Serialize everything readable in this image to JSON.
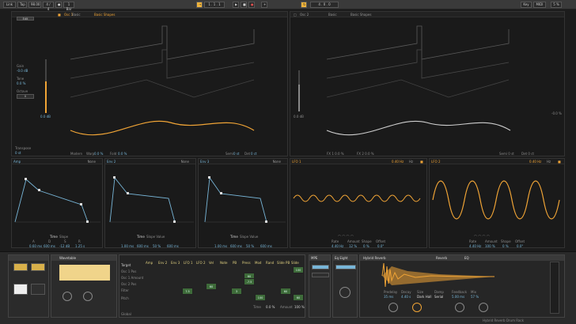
{
  "transport": {
    "link": "Link",
    "tempo_left": "Tempo",
    "tap": "Tap",
    "tempo": "98.00",
    "time_sig": "4 / 4",
    "metro": "1 Bar",
    "position": "1 . 1 . 1",
    "key": "Key",
    "midi": "MIDI",
    "cpu": "5 %"
  },
  "osc1": {
    "title": "Osc 1",
    "wave": "Basic",
    "preset": "Basic Shapes",
    "gain_label": "Gain",
    "gain": "-0.0 dB",
    "tone_label": "Tone",
    "tone": "0.0 %",
    "octave_label": "Octave",
    "octave": "0",
    "level": "0.0 dB",
    "modern": "Modern",
    "warp_label": "Warp",
    "warp": "0.0 %",
    "fold_label": "Fold",
    "fold": "0.0 %",
    "semi_label": "Semi",
    "semi": "0 st",
    "det_label": "Det",
    "det": "0 ct",
    "transpose_label": "Transpose",
    "transpose": "0 st",
    "left_btn": "Edit"
  },
  "osc2": {
    "title": "Osc 2",
    "wave": "Basic",
    "preset": "Basic Shapes",
    "level": "0.0 dB",
    "level_r": "-0.0 %",
    "fx1": "FX 1  0.0 %",
    "fx2": "FX 2  0.0 %",
    "semi": "Semi  0 st",
    "det": "Det  0 ct"
  },
  "env": [
    {
      "title": "Amp",
      "mode": "None",
      "a": "A",
      "d": "D",
      "s": "S",
      "r": "R",
      "a_val": "0.60 ms",
      "d_val": "600 ms",
      "s_val": "-12 dB",
      "r_val": "1.25 s",
      "time_label": "Time",
      "slope": "Slope"
    },
    {
      "title": "Env 2",
      "mode": "None",
      "a_val": "1.00 ms",
      "d_val": "600 ms",
      "s_val": "50 %",
      "r_val": "600 ms",
      "time_label": "Time",
      "slope": "Slope  Value"
    },
    {
      "title": "Env 3",
      "mode": "None",
      "a_val": "1.00 ms",
      "d_val": "600 ms",
      "s_val": "50 %",
      "r_val": "600 ms",
      "time_label": "Time",
      "slope": "Slope  Value"
    }
  ],
  "lfo1": {
    "title": "LFO 1",
    "rate_hz": "0.40 Hz",
    "hz": "Hz",
    "rate_label": "Rate",
    "amount_label": "Amount",
    "shape_label": "Shape",
    "offset_label": "Offset",
    "rate": "4.40 Hz",
    "amount": "12 %",
    "shape": "0 %",
    "offset": "0.0°"
  },
  "lfo2": {
    "title": "LFO 2",
    "rate_hz": "0.40 Hz",
    "hz": "Hz",
    "rate_label": "Rate",
    "amount_label": "Amount",
    "shape_label": "Shape",
    "offset_label": "Offset",
    "rate": "4.40 Hz",
    "amount": "100 %",
    "shape": "0 %",
    "offset": "0.0°"
  },
  "bottom": {
    "track": "Wavetable",
    "target": "Target",
    "matrix_cols": [
      "Amp",
      "Env 2",
      "Env 3",
      "LFO 1",
      "LFO 2",
      "Vel",
      "Note",
      "PB",
      "Press",
      "Mod",
      "Rand",
      "Slide PB",
      "Slide"
    ],
    "matrix_rows": [
      "Osc 1 Pos",
      "Osc 1 Amount",
      "Osc 2 Pos",
      "Filter",
      "Global",
      "Pitch"
    ],
    "matrix_values": [
      "100",
      "60",
      "60",
      "-7.5",
      "7.5",
      "60",
      "3",
      "100",
      "60"
    ],
    "time": "Time",
    "time_val": "0.0 %",
    "amount": "Amount",
    "amount_val": "100 %",
    "global": "Global",
    "mono": "MPE",
    "eq_title": "Eq Eight",
    "reverb_title": "Hybrid Reverb",
    "reverb_tabs": [
      "Reverb",
      "EQ"
    ],
    "reverb_params": [
      "Predelay",
      "Decay",
      "Size",
      "Damp",
      "Feedback",
      "Mix"
    ],
    "reverb_values": [
      "35 ms",
      "4.40 s",
      "Dark Hall",
      "Serial",
      "5.00 ms",
      "57 %"
    ],
    "status": "Hybrid Reverb   Drum Rack"
  },
  "colors": {
    "accent": "#f0a436",
    "blue": "#78b6d8",
    "matrix_green": "#3e6b3a"
  }
}
